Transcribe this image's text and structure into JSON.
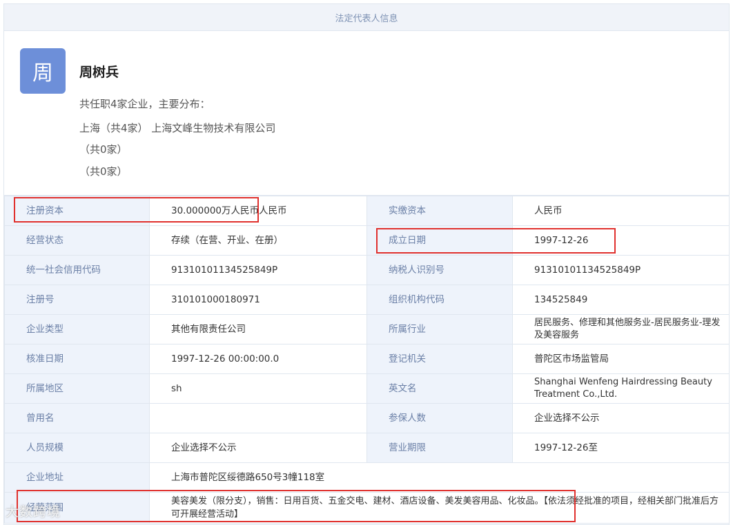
{
  "header": {
    "title": "法定代表人信息"
  },
  "person": {
    "avatar_char": "周",
    "name": "周树兵",
    "summary": "共任职4家企业，主要分布：",
    "lines": [
      "上海（共4家） 上海文峰生物技术有限公司",
      "（共0家）",
      "（共0家）"
    ]
  },
  "rows": [
    {
      "l1": "注册资本",
      "v1": "30.000000万人民币人民币",
      "l2": "实缴资本",
      "v2": "人民币"
    },
    {
      "l1": "经营状态",
      "v1": "存续（在营、开业、在册）",
      "l2": "成立日期",
      "v2": "1997-12-26"
    },
    {
      "l1": "统一社会信用代码",
      "v1": "91310101134525849P",
      "l2": "纳税人识别号",
      "v2": "91310101134525849P"
    },
    {
      "l1": "注册号",
      "v1": "310101000180971",
      "l2": "组织机构代码",
      "v2": "134525849"
    },
    {
      "l1": "企业类型",
      "v1": "其他有限责任公司",
      "l2": "所属行业",
      "v2": "居民服务、修理和其他服务业-居民服务业-理发及美容服务"
    },
    {
      "l1": "核准日期",
      "v1": "1997-12-26 00:00:00.0",
      "l2": "登记机关",
      "v2": "普陀区市场监管局"
    },
    {
      "l1": "所属地区",
      "v1": "sh",
      "l2": "英文名",
      "v2": "Shanghai Wenfeng Hairdressing Beauty Treatment Co.,Ltd."
    },
    {
      "l1": "曾用名",
      "v1": "",
      "l2": "参保人数",
      "v2": "企业选择不公示"
    },
    {
      "l1": "人员规模",
      "v1": "企业选择不公示",
      "l2": "营业期限",
      "v2": "1997-12-26至"
    }
  ],
  "address": {
    "label": "企业地址",
    "value": "上海市普陀区绥德路650号3幢118室"
  },
  "scope": {
    "label": "经营范围",
    "value": "美容美发（限分支），销售：日用百货、五金交电、建材、酒店设备、美发美容用品、化妆品。【依法须经批准的项目，经相关部门批准后方可开展经营活动】"
  },
  "watermark": "大数跨境",
  "highlight_color": "#e0302d"
}
